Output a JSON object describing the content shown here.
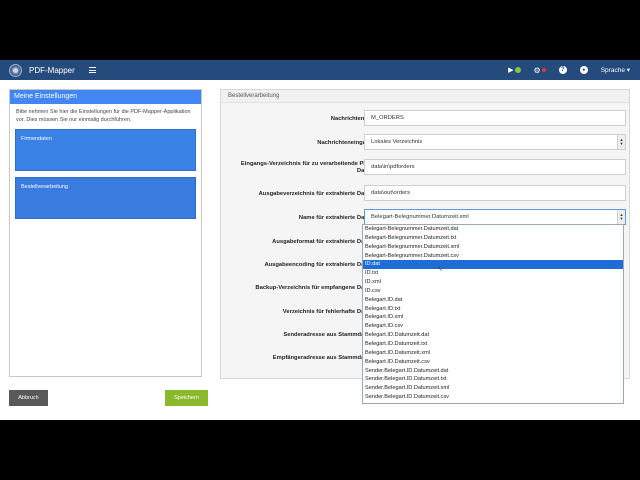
{
  "navbar": {
    "brand": "PDF-Mapper",
    "status_indicator": "",
    "language_label": "Sprache ▾",
    "help_glyph": "?",
    "user_glyph": "●"
  },
  "left": {
    "title": "Meine Einstellungen",
    "description": "Bitte nehmen Sie hier die Einstellungen für die PDF-Mapper-Applikation vor. Dies müssen Sie nur einmalig durchführen.",
    "cards": [
      {
        "label": "Firmendaten"
      },
      {
        "label": "Bestellverarbeitung"
      }
    ]
  },
  "right": {
    "title": "Bestellverarbeitung",
    "fields": [
      {
        "label": "Nachrichtentyp",
        "value": "M_ORDERS"
      },
      {
        "label": "Nachrichteneingang",
        "value": "Lokales Verzeichnis"
      },
      {
        "label": "Eingangs-Verzeichnis für zu verarbeitende PDF-Daten",
        "value": "data\\in\\pdforders"
      },
      {
        "label": "Ausgabeverzeichnis für extrahierte Daten",
        "value": "data\\out\\orders"
      },
      {
        "label": "Name für extrahierte Daten",
        "value": "Belegart-Belegnummer.Datumzeit.xml"
      },
      {
        "label": "Ausgabeformat für extrahierte Daten",
        "value": ""
      },
      {
        "label": "Ausgabeencoding für extrahierte Daten",
        "value": ""
      },
      {
        "label": "Backup-Verzeichnis für empfangene Daten",
        "value": ""
      },
      {
        "label": "Verzeichnis für fehlerhafte Daten",
        "value": ""
      },
      {
        "label": "Senderadresse aus Stammdaten",
        "value": ""
      },
      {
        "label": "Empfängeradresse aus Stammdaten",
        "value": ""
      }
    ]
  },
  "dropdown": {
    "options": [
      "Belegart-Belegnummer.Datumzeit.dat",
      "Belegart-Belegnummer.Datumzeit.txt",
      "Belegart-Belegnummer.Datumzeit.xml",
      "Belegart-Belegnummer.Datumzeit.csv",
      "ID.dat",
      "ID.txt",
      "ID.xml",
      "ID.csv",
      "Belegart.ID.dat",
      "Belegart.ID.txt",
      "Belegart.ID.xml",
      "Belegart.ID.csv",
      "Belegart.ID.Datumzeit.dat",
      "Belegart.ID.Datumzeit.txt",
      "Belegart.ID.Datumzeit.xml",
      "Belegart.ID.Datumzeit.csv",
      "Sender.Belegart.ID.Datumzeit.dat",
      "Sender.Belegart.ID.Datumzeit.txt",
      "Sender.Belegart.ID.Datumzeit.xml",
      "Sender.Belegart.ID.Datumzeit.csv"
    ],
    "highlighted": "ID.dat"
  },
  "buttons": {
    "cancel": "Abbruch",
    "save": "Speichern"
  },
  "colors": {
    "navbar": "#254a7c",
    "accent_blue": "#4285f4",
    "save_green": "#8ab92d",
    "cancel_gray": "#595959"
  }
}
